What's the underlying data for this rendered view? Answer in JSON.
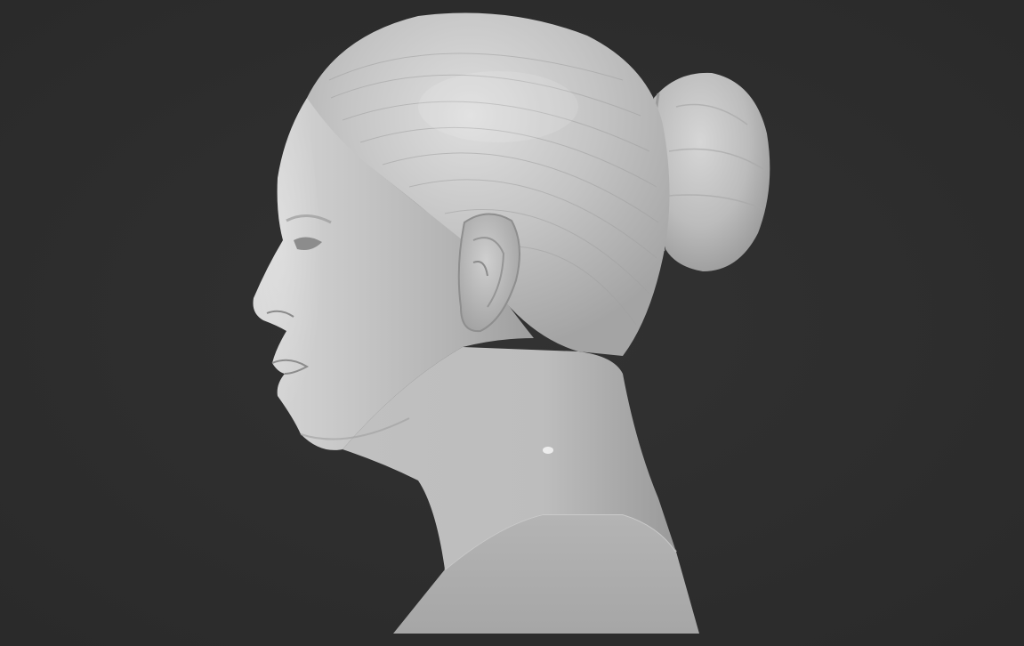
{
  "scene": {
    "background_color": "#2d2d2d",
    "subject": "bust-sculpture-profile",
    "material_color": "#bcbcbc",
    "facing": "left"
  }
}
